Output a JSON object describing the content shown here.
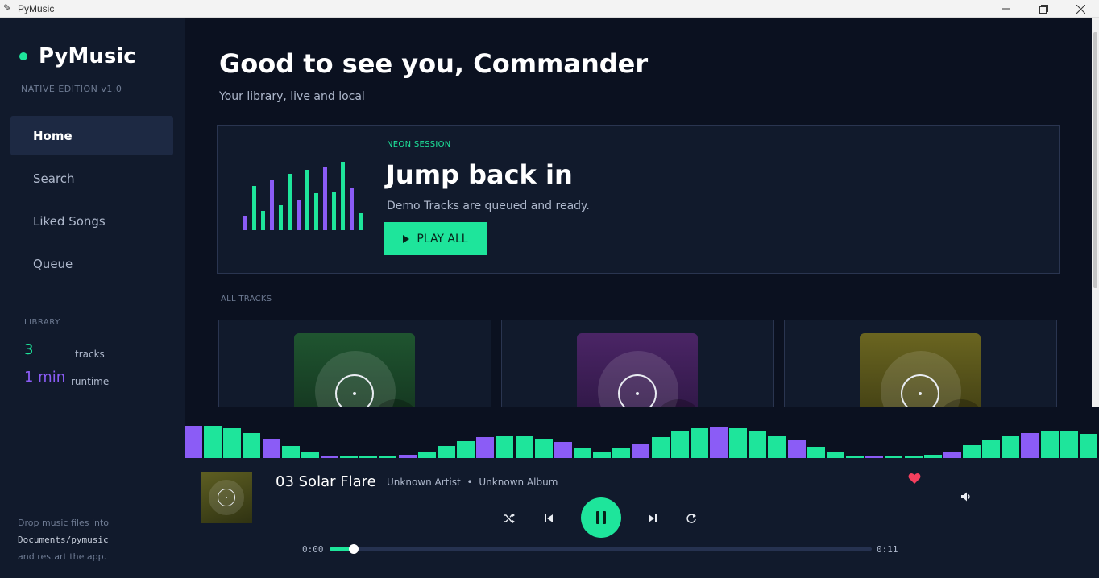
{
  "window": {
    "title": "PyMusic"
  },
  "colors": {
    "accent_green": "#1ee59b",
    "accent_purple": "#8b5cf6",
    "heart_red": "#f43f5e",
    "bg_dark": "#0b1120",
    "panel": "#111a2c"
  },
  "sidebar": {
    "brand": "PyMusic",
    "edition": "NATIVE  EDITION  v1.0",
    "nav": [
      {
        "label": "Home",
        "active": true,
        "icon": "home-icon"
      },
      {
        "label": "Search",
        "active": false,
        "icon": "search-icon"
      },
      {
        "label": "Liked Songs",
        "active": false,
        "icon": "heart-icon"
      },
      {
        "label": "Queue",
        "active": false,
        "icon": "queue-icon"
      }
    ],
    "library": {
      "title": "LIBRARY",
      "count": "3",
      "count_label": "tracks",
      "runtime": "1 min",
      "runtime_label": "runtime"
    },
    "drop_hint": {
      "line1": "Drop music files into",
      "path": "Documents/pymusic",
      "line3": "and restart the app."
    }
  },
  "main": {
    "greeting": "Good to see you, Commander",
    "subtitle": "Your library, live and local",
    "hero": {
      "tag": "NEON SESSION",
      "title": "Jump back in",
      "description": "Demo Tracks are queued and ready.",
      "button_label": "PLAY ALL",
      "button_icon": "play-icon",
      "visualizer": [
        {
          "level": 0.2,
          "color": "purple"
        },
        {
          "level": 0.63,
          "color": "green"
        },
        {
          "level": 0.27,
          "color": "green"
        },
        {
          "level": 0.7,
          "color": "purple"
        },
        {
          "level": 0.35,
          "color": "green"
        },
        {
          "level": 0.8,
          "color": "green"
        },
        {
          "level": 0.42,
          "color": "purple"
        },
        {
          "level": 0.85,
          "color": "green"
        },
        {
          "level": 0.52,
          "color": "green"
        },
        {
          "level": 0.9,
          "color": "purple"
        },
        {
          "level": 0.55,
          "color": "green"
        },
        {
          "level": 0.97,
          "color": "green"
        },
        {
          "level": 0.6,
          "color": "purple"
        },
        {
          "level": 0.25,
          "color": "green"
        }
      ]
    },
    "tracks_label": "ALL TRACKS",
    "tracks": [
      {
        "art_colors": [
          "#1f5530",
          "#13311d"
        ]
      },
      {
        "art_colors": [
          "#4b2566",
          "#2a1540"
        ]
      },
      {
        "art_colors": [
          "#6a6520",
          "#3c3a12"
        ]
      }
    ]
  },
  "visualizer": {
    "bars": [
      {
        "level": 0.63,
        "color": "purple"
      },
      {
        "level": 0.62,
        "color": "green"
      },
      {
        "level": 0.58,
        "color": "green"
      },
      {
        "level": 0.48,
        "color": "green"
      },
      {
        "level": 0.38,
        "color": "purple"
      },
      {
        "level": 0.24,
        "color": "green"
      },
      {
        "level": 0.13,
        "color": "green"
      },
      {
        "level": 0.03,
        "color": "purple"
      },
      {
        "level": 0.04,
        "color": "green"
      },
      {
        "level": 0.04,
        "color": "green"
      },
      {
        "level": 0.03,
        "color": "green"
      },
      {
        "level": 0.06,
        "color": "purple"
      },
      {
        "level": 0.13,
        "color": "green"
      },
      {
        "level": 0.23,
        "color": "green"
      },
      {
        "level": 0.33,
        "color": "green"
      },
      {
        "level": 0.4,
        "color": "purple"
      },
      {
        "level": 0.43,
        "color": "green"
      },
      {
        "level": 0.43,
        "color": "green"
      },
      {
        "level": 0.38,
        "color": "green"
      },
      {
        "level": 0.31,
        "color": "purple"
      },
      {
        "level": 0.19,
        "color": "green"
      },
      {
        "level": 0.12,
        "color": "green"
      },
      {
        "level": 0.19,
        "color": "green"
      },
      {
        "level": 0.28,
        "color": "purple"
      },
      {
        "level": 0.4,
        "color": "green"
      },
      {
        "level": 0.52,
        "color": "green"
      },
      {
        "level": 0.58,
        "color": "green"
      },
      {
        "level": 0.6,
        "color": "purple"
      },
      {
        "level": 0.58,
        "color": "green"
      },
      {
        "level": 0.51,
        "color": "green"
      },
      {
        "level": 0.44,
        "color": "green"
      },
      {
        "level": 0.35,
        "color": "purple"
      },
      {
        "level": 0.22,
        "color": "green"
      },
      {
        "level": 0.13,
        "color": "green"
      },
      {
        "level": 0.05,
        "color": "green"
      },
      {
        "level": 0.03,
        "color": "purple"
      },
      {
        "level": 0.03,
        "color": "green"
      },
      {
        "level": 0.03,
        "color": "green"
      },
      {
        "level": 0.06,
        "color": "green"
      },
      {
        "level": 0.13,
        "color": "purple"
      },
      {
        "level": 0.25,
        "color": "green"
      },
      {
        "level": 0.35,
        "color": "green"
      },
      {
        "level": 0.43,
        "color": "green"
      },
      {
        "level": 0.48,
        "color": "purple"
      },
      {
        "level": 0.52,
        "color": "green"
      },
      {
        "level": 0.52,
        "color": "green"
      },
      {
        "level": 0.47,
        "color": "green"
      }
    ]
  },
  "player": {
    "title": "03 Solar Flare",
    "artist": "Unknown Artist",
    "separator": "•",
    "album": "Unknown Album",
    "liked": true,
    "time_current": "0:00",
    "time_total": "0:11",
    "progress": 0.045,
    "controls": {
      "shuffle_icon": "shuffle-icon",
      "prev_icon": "skip-previous-icon",
      "play_pause_icon": "pause-icon",
      "next_icon": "skip-next-icon",
      "repeat_icon": "repeat-icon",
      "volume_icon": "volume-icon"
    }
  }
}
